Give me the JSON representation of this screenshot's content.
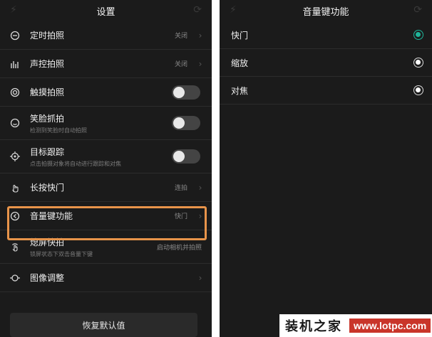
{
  "left_screen": {
    "title": "设置",
    "items": [
      {
        "icon": "timer-icon",
        "title": "定时拍照",
        "value": "关闭",
        "control": "chevron"
      },
      {
        "icon": "sound-bars-icon",
        "title": "声控拍照",
        "value": "关闭",
        "control": "chevron"
      },
      {
        "icon": "touch-circle-icon",
        "title": "触摸拍照",
        "control": "toggle",
        "on": false
      },
      {
        "icon": "smile-icon",
        "title": "笑脸抓拍",
        "subtitle": "检测到笑脸时自动拍照",
        "control": "toggle",
        "on": false
      },
      {
        "icon": "target-icon",
        "title": "目标跟踪",
        "subtitle": "点击拍摄对象将自动进行跟踪和对焦",
        "control": "toggle",
        "on": false
      },
      {
        "icon": "hand-press-icon",
        "title": "长按快门",
        "value": "连拍",
        "control": "chevron"
      },
      {
        "icon": "volume-key-icon",
        "title": "音量键功能",
        "value": "快门",
        "control": "chevron"
      },
      {
        "icon": "screen-off-icon",
        "title": "熄屏快拍",
        "subtitle": "锁屏状态下双击音量下键",
        "value": "启动相机并拍照",
        "control": "none"
      },
      {
        "icon": "adjust-icon",
        "title": "图像调整",
        "control": "chevron"
      }
    ],
    "reset_label": "恢复默认值",
    "highlight_color": "#e8944a"
  },
  "right_screen": {
    "title": "音量键功能",
    "options": [
      {
        "label": "快门",
        "selected": true
      },
      {
        "label": "缩放",
        "selected": false
      },
      {
        "label": "对焦",
        "selected": false
      }
    ],
    "accent_color": "#1fb59a"
  },
  "watermark": {
    "site_name": "装机之家",
    "url": "www.lotpc.com"
  }
}
